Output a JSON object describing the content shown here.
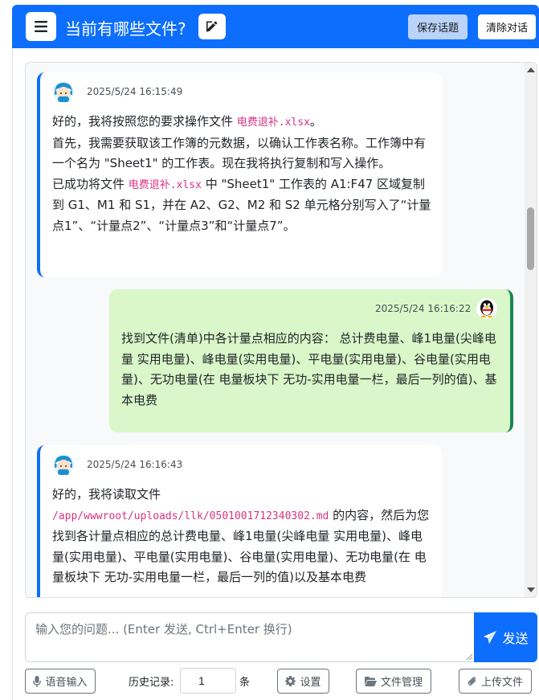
{
  "header": {
    "title": "当前有哪些文件?",
    "save_topic_label": "保存话题",
    "clear_chat_label": "清除对话",
    "icons": {
      "menu": "hamburger-icon",
      "edit": "edit-icon"
    }
  },
  "messages": [
    {
      "role": "assistant",
      "timestamp": "2025/5/24 16:15:49",
      "avatar": "assistant-avatar-icon",
      "line1_pre": "好的，我将按照您的要求操作文件 ",
      "line1_code": "电费退补.xlsx",
      "line1_post": "。",
      "line2": "首先，我需要获取该工作簿的元数据，以确认工作表名称。工作簿中有一个名为 \"Sheet1\" 的工作表。现在我将执行复制和写入操作。",
      "line3_pre": "已成功将文件 ",
      "line3_code": "电费退补.xlsx",
      "line3_post": " 中 \"Sheet1\" 工作表的 A1:F47 区域复制到 G1、M1 和 S1，并在 A2、G2、M2 和 S2 单元格分别写入了“计量点1”、“计量点2”、“计量点3”和“计量点7”。"
    },
    {
      "role": "user",
      "timestamp": "2025/5/24 16:16:22",
      "avatar": "qq-penguin-avatar-icon",
      "text": "找到文件(清单)中各计量点相应的内容： 总计费电量、峰1电量(尖峰电量 实用电量)、峰电量(实用电量)、平电量(实用电量)、谷电量(实用电量)、无功电量(在 电量板块下 无功-实用电量一栏，最后一列的值)、基本电费"
    },
    {
      "role": "assistant",
      "timestamp": "2025/5/24 16:16:43",
      "avatar": "assistant-avatar-icon",
      "line1": "好的，我将读取文件",
      "path_code": "/app/wwwroot/uploads/llk/0501001712340302.md",
      "line2": " 的内容，然后为您找到各计量点相应的总计费电量、峰1电量(尖峰电量 实用电量)、峰电量(实用电量)、平电量(实用电量)、谷电量(实用电量)、无功电量(在 电量板块下 无功-实用电量一栏，最后一列的值)以及基本电费"
    }
  ],
  "input": {
    "placeholder": "输入您的问题... (Enter 发送, Ctrl+Enter 换行)",
    "send_label": "发送"
  },
  "toolbar": {
    "voice_label": "语音输入",
    "history_label": "历史记录:",
    "history_value": "1",
    "history_unit": "条",
    "settings_label": "设置",
    "files_label": "文件管理",
    "upload_label": "上传文件"
  },
  "colors": {
    "primary": "#0d6efd",
    "user_bubble": "#d9f7c9",
    "user_border": "#198754",
    "code": "#d63384"
  }
}
